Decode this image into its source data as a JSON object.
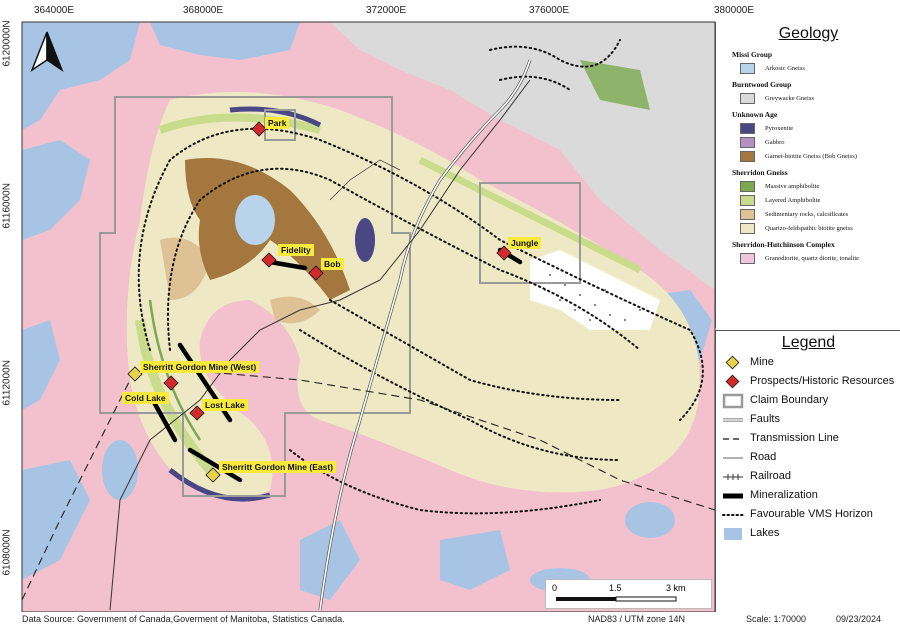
{
  "map": {
    "x_ticks": [
      "364000E",
      "368000E",
      "372000E",
      "376000E",
      "380000E"
    ],
    "y_ticks": [
      "6120000N",
      "6116000N",
      "6112000N",
      "6108000N"
    ],
    "north_arrow": "north-arrow",
    "colors": {
      "background_granodiorite": "#f2c1cd",
      "quartzo_feldspathic": "#efe8c4",
      "lakes": "#a8c4e4",
      "greywacke": "#dadada",
      "garnet_biotite": "#a4773e",
      "pyroxenite": "#4a4785",
      "gabbro": "#b48fc2",
      "massive_amphibolite": "#7aa94f",
      "layered_amphibolite": "#c8dc8c",
      "sedimentary": "#dfc196",
      "arkosic": "#b8d4ec",
      "mine": "#e8d14a",
      "prospect": "#d22a2a",
      "claim": "#9a9a9a"
    }
  },
  "labels": {
    "park": "Park",
    "jungle": "Jungle",
    "fidelity": "Fidelity",
    "bob": "Bob",
    "sg_west": "Sherritt Gordon Mine (West)",
    "cold_lake": "Cold Lake",
    "lost_lake": "Lost Lake",
    "sg_east": "Sherritt Gordon Mine (East)"
  },
  "geology": {
    "title": "Geology",
    "groups": [
      {
        "name": "Missi Group",
        "items": [
          {
            "label": "Arkosic Gneiss",
            "color": "#b8d4ec"
          }
        ]
      },
      {
        "name": "Burntwood Group",
        "items": [
          {
            "label": "Greywacke Gneiss",
            "color": "#dadada"
          }
        ]
      },
      {
        "name": "Unknown Age",
        "items": [
          {
            "label": "Pyroxenite",
            "color": "#4a4785"
          },
          {
            "label": "Gabbro",
            "color": "#b48fc2"
          },
          {
            "label": "Garnet-biotite Gneiss (Bob Gneiss)",
            "color": "#a4773e"
          }
        ]
      },
      {
        "name": "Sherridon Gneiss",
        "items": [
          {
            "label": "Massive amphibolite",
            "color": "#7aa94f"
          },
          {
            "label": "Layered Amphibolite",
            "color": "#c8dc8c"
          },
          {
            "label": "Sedimentary rocks, calcsilicates",
            "color": "#dfc196"
          },
          {
            "label": "Quartzo-feldspathic biotite gneiss",
            "color": "#efe8c4"
          }
        ]
      },
      {
        "name": "Sherridon-Hutchinson Complex",
        "items": [
          {
            "label": "Granodiorite, quartz diorite, tonalite",
            "color": "#efc6dc"
          }
        ]
      }
    ]
  },
  "legend": {
    "title": "Legend",
    "items": [
      {
        "label": "Mine",
        "symbol": "mine-diamond"
      },
      {
        "label": "Prospects/Historic Resources",
        "symbol": "prospect-diamond"
      },
      {
        "label": "Claim Boundary",
        "symbol": "claim-box"
      },
      {
        "label": "Faults",
        "symbol": "fault-line"
      },
      {
        "label": "Transmission Line",
        "symbol": "dashed-line"
      },
      {
        "label": "Road",
        "symbol": "thin-line"
      },
      {
        "label": "Railroad",
        "symbol": "rail-line"
      },
      {
        "label": "Mineralization",
        "symbol": "thick-line"
      },
      {
        "label": "Favourable VMS Horizon",
        "symbol": "dotted-line"
      },
      {
        "label": "Lakes",
        "symbol": "lake-box"
      }
    ]
  },
  "scale": {
    "ticks": [
      "0",
      "1.5",
      "3 km"
    ]
  },
  "footer": {
    "source": "Data Source: Government of Canada,Goverment of Manitoba, Statistics Canada.",
    "projection": "NAD83 / UTM zone 14N",
    "scale": "Scale: 1:70000",
    "date": "09/23/2024"
  }
}
